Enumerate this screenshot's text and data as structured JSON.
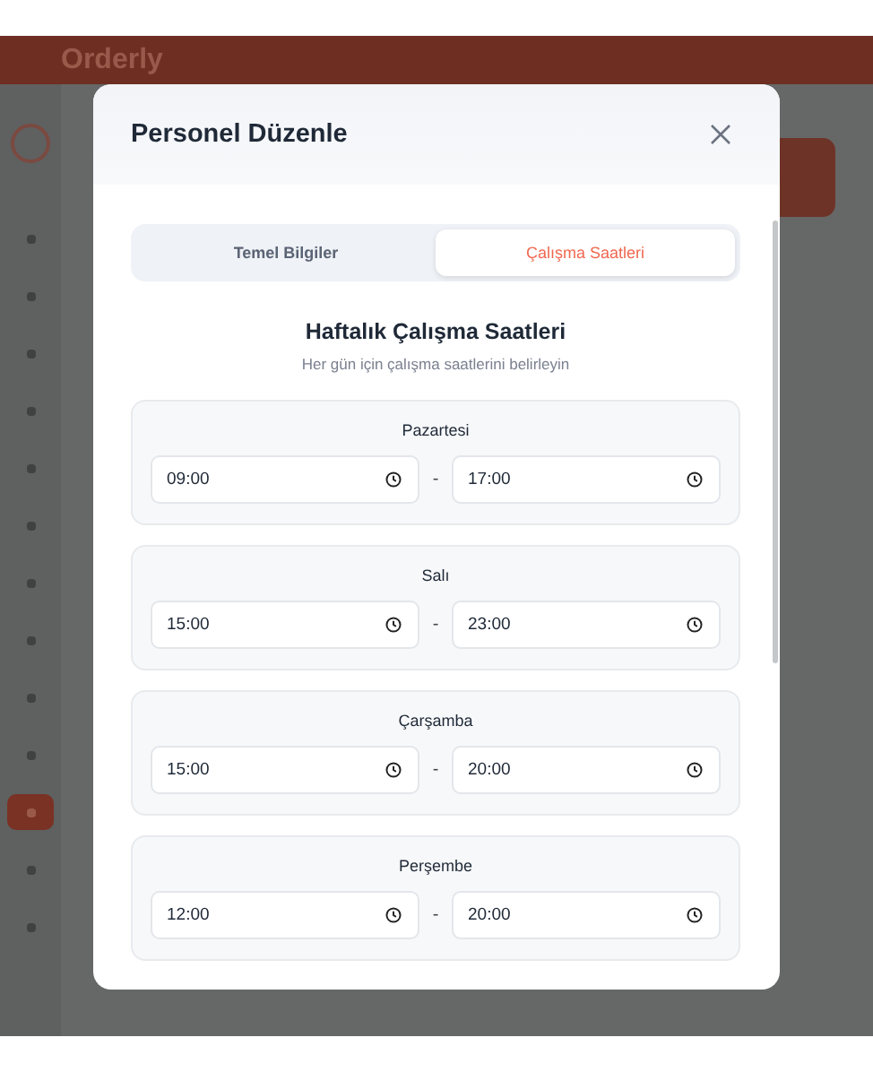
{
  "app": {
    "name": "Orderly"
  },
  "sidebar": {
    "items": [
      {
        "selected": false
      },
      {
        "selected": false
      },
      {
        "selected": false
      },
      {
        "selected": false
      },
      {
        "selected": false
      },
      {
        "selected": false
      },
      {
        "selected": false
      },
      {
        "selected": false
      },
      {
        "selected": false
      },
      {
        "selected": false
      },
      {
        "selected": true
      },
      {
        "selected": false
      },
      {
        "selected": false
      }
    ]
  },
  "modal": {
    "title": "Personel Düzenle",
    "tabs": [
      {
        "label": "Temel Bilgiler",
        "selected": false
      },
      {
        "label": "Çalışma Saatleri",
        "selected": true
      }
    ],
    "heading": "Haftalık Çalışma Saatleri",
    "subheading": "Her gün için çalışma saatlerini belirleyin",
    "days": [
      {
        "name": "Pazartesi",
        "start": "09:00",
        "separator": "-",
        "end": "17:00"
      },
      {
        "name": "Salı",
        "start": "15:00",
        "separator": "-",
        "end": "23:00"
      },
      {
        "name": "Çarşamba",
        "start": "15:00",
        "separator": "-",
        "end": "20:00"
      },
      {
        "name": "Perşembe",
        "start": "12:00",
        "separator": "-",
        "end": "20:00"
      }
    ]
  }
}
